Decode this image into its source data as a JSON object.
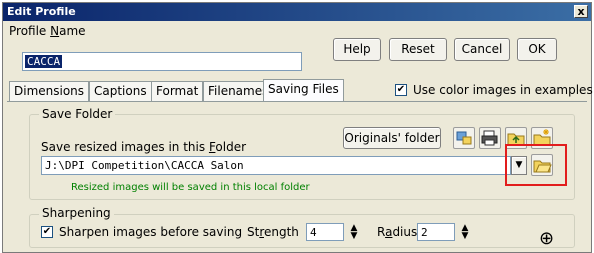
{
  "window": {
    "title": "Edit Profile",
    "close_glyph": "x"
  },
  "profile_name": {
    "label_pre": "Profile ",
    "label_u": "N",
    "label_post": "ame",
    "value": "CACCA"
  },
  "buttons": {
    "help": "Help",
    "reset": "Reset",
    "cancel": "Cancel",
    "ok": "OK"
  },
  "tabs": [
    {
      "label": "Dimensions"
    },
    {
      "label": "Captions"
    },
    {
      "label": "Format"
    },
    {
      "label": "Filenames"
    },
    {
      "label": "Saving Files",
      "active": true
    }
  ],
  "use_color_images": {
    "label": "Use color images in examples",
    "checked": true
  },
  "save_folder": {
    "legend": "Save Folder",
    "label_pre": "Save resized images in this ",
    "label_u": "F",
    "label_post": "older",
    "originals_button": "Originals' folder",
    "path": "J:\\DPI Competition\\CACCA Salon",
    "note": "Resized images will be saved in this local folder"
  },
  "sharpening": {
    "legend": "Sharpening",
    "checkbox_label": "Sharpen images before saving",
    "checked": true,
    "strength_label_pre": "St",
    "strength_label_u": "r",
    "strength_label_post": "ength",
    "strength_value": "4",
    "radius_label_pre": "R",
    "radius_label_u": "a",
    "radius_label_post": "dius",
    "radius_value": "2"
  },
  "glyphs": {
    "check": "✔",
    "dropdown": "▼",
    "up": "▲",
    "down": "▼",
    "crosshair": "⊕"
  },
  "colors": {
    "title_bar": "#0a246a",
    "note_text": "#008000",
    "highlight_box": "#e21d1d"
  }
}
